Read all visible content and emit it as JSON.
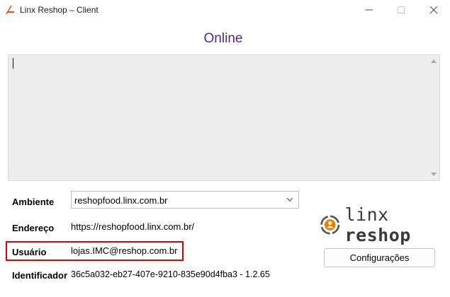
{
  "window": {
    "title": "Linx Reshop – Client",
    "icon": "linx-app-icon",
    "controls": [
      "minimize",
      "maximize",
      "close"
    ]
  },
  "status": {
    "text": "Online",
    "color": "#4b2a8a"
  },
  "log": {
    "text": ""
  },
  "form": {
    "ambiente_label": "Ambiente",
    "ambiente_value": "reshopfood.linx.com.br",
    "endereco_label": "Endereço",
    "endereco_value": "https://reshopfood.linx.com.br/",
    "usuario_label": "Usuário",
    "usuario_value": "lojas.IMC@reshop.com.br",
    "identificador_label": "Identificador",
    "identificador_value": "36c5a032-eb27-407e-9210-835e90d4fba3 - 1.2.65"
  },
  "logo": {
    "part1": "linx",
    "part2": "reshop",
    "accent": "#f07d00"
  },
  "buttons": {
    "config_label": "Configurações"
  },
  "highlight_color": "#e00000"
}
